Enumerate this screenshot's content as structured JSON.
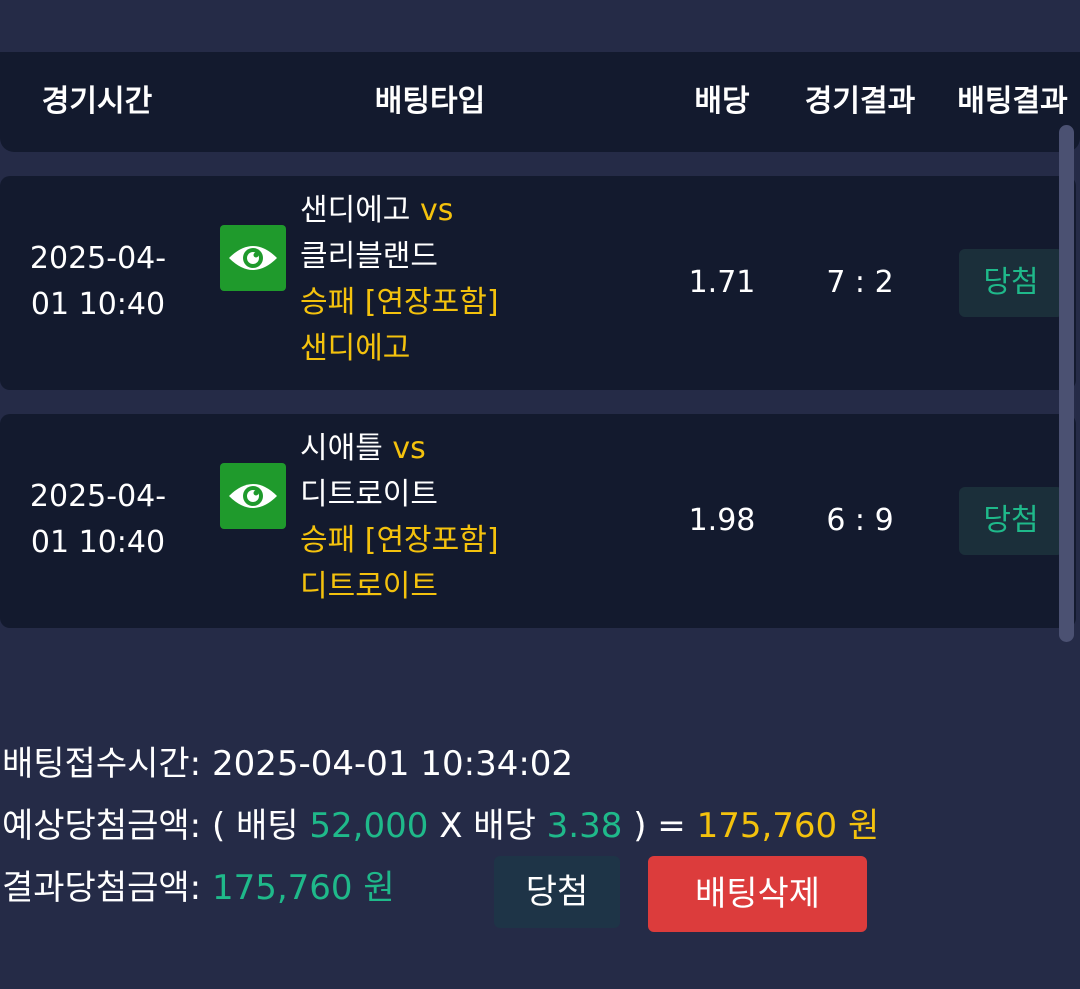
{
  "header": {
    "col_time": "경기시간",
    "col_type": "배팅타입",
    "col_odds": "배당",
    "col_game_result": "경기결과",
    "col_bet_result": "배팅결과"
  },
  "rows": [
    {
      "time_line1": "2025-04-",
      "time_line2": "01 10:40",
      "home": "샌디에고",
      "vs": "vs",
      "away": "클리블랜드",
      "market": "승패 [연장포함]",
      "pick": "샌디에고",
      "odds": "1.71",
      "score": "7 : 2",
      "result": "당첨"
    },
    {
      "time_line1": "2025-04-",
      "time_line2": "01 10:40",
      "home": "시애틀",
      "vs": "vs",
      "away": "디트로이트",
      "market": "승패 [연장포함]",
      "pick": "디트로이트",
      "odds": "1.98",
      "score": "6 : 9",
      "result": "당첨"
    }
  ],
  "summary": {
    "received_label": "배팅접수시간:",
    "received_value": "2025-04-01 10:34:02",
    "expected_label": "예상당첨금액:",
    "expected_open": "( 배팅",
    "bet_amount": "52,000",
    "times_label": "X 배당",
    "total_odds": "3.38",
    "expected_close": ") =",
    "expected_amount": "175,760 원",
    "result_label": "결과당첨금액:",
    "result_amount": "175,760 원"
  },
  "actions": {
    "status_label": "당첨",
    "delete_label": "배팅삭제"
  },
  "icons": {
    "view": "eye-icon"
  },
  "colors": {
    "background": "#252b47",
    "panel": "#131a2e",
    "accent_yellow": "#f4c20d",
    "accent_green": "#1fb98a",
    "eye_button": "#1f9a2c",
    "delete_button": "#dc3c3c"
  }
}
